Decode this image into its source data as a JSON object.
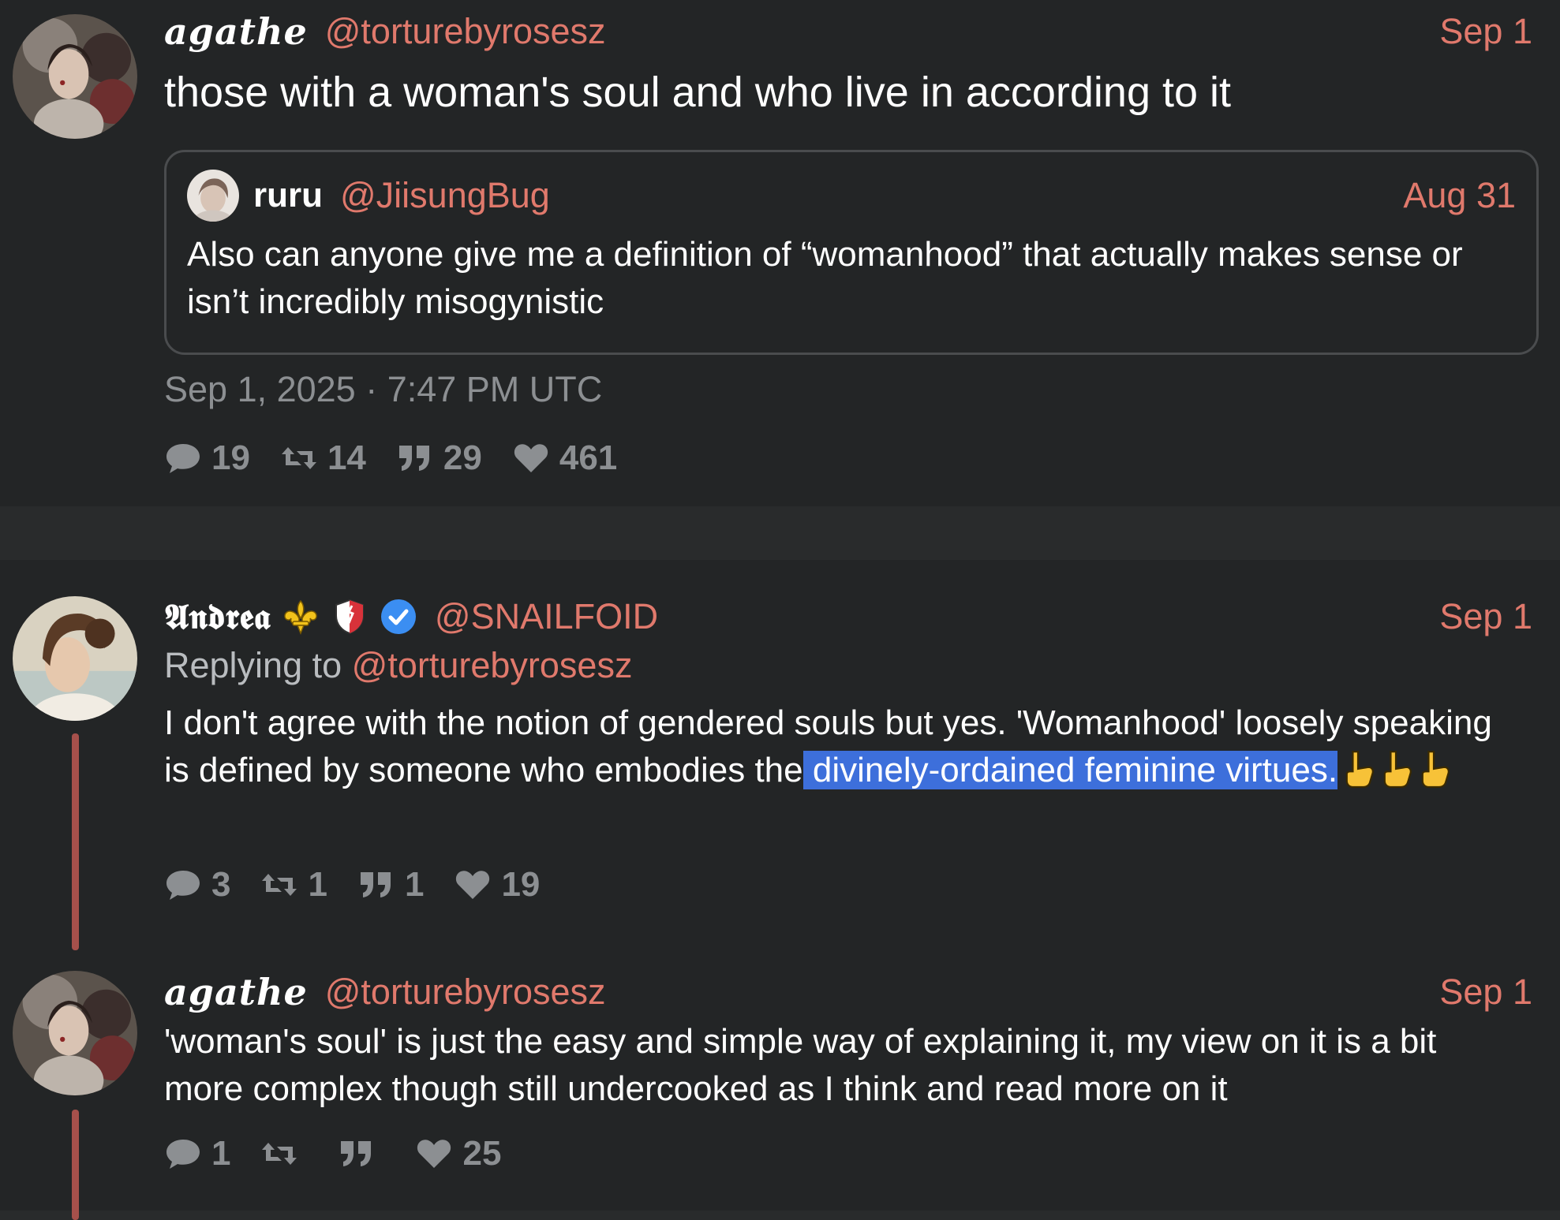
{
  "tweets": [
    {
      "display_name": "agathe",
      "handle": "@torturebyrosesz",
      "date": "Sep 1",
      "text": "those with a woman's soul and who live in according to it",
      "quote": {
        "display_name": "ruru",
        "handle": "@JiisungBug",
        "date": "Aug 31",
        "text": "Also can anyone give me a definition of “womanhood” that actually makes sense or isn’t incredibly misogynistic"
      },
      "timestamp": "Sep 1, 2025 · 7:47 PM UTC",
      "stats": {
        "replies": "19",
        "retweets": "14",
        "quotes": "29",
        "likes": "461"
      }
    }
  ],
  "replies": [
    {
      "display_name": "𝕬𝖓𝖉𝖗𝖊𝖆",
      "badges": [
        "fleur-de-lis-emoji",
        "shield-emoji",
        "verified-badge-icon"
      ],
      "handle": "@SNAILFOID",
      "date": "Sep 1",
      "replying_to_label": "Replying to",
      "replying_to_handle": "@torturebyrosesz",
      "text_before": "I don't agree with the notion of gendered souls but yes. 'Womanhood' loosely speaking is defined by someone who embodies the",
      "text_highlighted": " divinely-ordained feminine virtues.",
      "emoji": "pointing-down-emoji",
      "stats": {
        "replies": "3",
        "retweets": "1",
        "quotes": "1",
        "likes": "19"
      }
    },
    {
      "display_name": "agathe",
      "handle": "@torturebyrosesz",
      "date": "Sep 1",
      "text": "'woman's soul' is just the easy and simple way of explaining it, my view on it is a bit more complex though still undercooked as I think and read more on it",
      "stats": {
        "replies": "1",
        "retweets": "",
        "quotes": "",
        "likes": "25"
      }
    }
  ],
  "colors": {
    "background": "#232526",
    "separator": "#292b2c",
    "accent": "#e0796c",
    "muted": "#8c8f92",
    "thread_line": "#a6504b",
    "highlight": "#3d6fdb"
  }
}
